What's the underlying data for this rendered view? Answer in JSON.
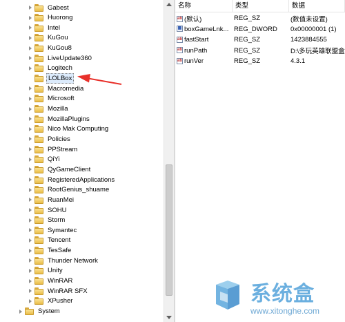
{
  "tree": {
    "items": [
      {
        "label": "Gabest"
      },
      {
        "label": "Huorong"
      },
      {
        "label": "Intel"
      },
      {
        "label": "KuGou"
      },
      {
        "label": "KuGou8"
      },
      {
        "label": "LiveUpdate360"
      },
      {
        "label": "Logitech"
      },
      {
        "label": "LOLBox",
        "selected": true
      },
      {
        "label": "Macromedia"
      },
      {
        "label": "Microsoft"
      },
      {
        "label": "Mozilla"
      },
      {
        "label": "MozillaPlugins"
      },
      {
        "label": "Nico Mak Computing"
      },
      {
        "label": "Policies"
      },
      {
        "label": "PPStream"
      },
      {
        "label": "QiYi"
      },
      {
        "label": "QyGameClient"
      },
      {
        "label": "RegisteredApplications"
      },
      {
        "label": "RootGenius_shuame"
      },
      {
        "label": "RuanMei"
      },
      {
        "label": "SOHU"
      },
      {
        "label": "Storm"
      },
      {
        "label": "Symantec"
      },
      {
        "label": "Tencent"
      },
      {
        "label": "TesSafe"
      },
      {
        "label": "Thunder Network"
      },
      {
        "label": "Unity"
      },
      {
        "label": "WinRAR"
      },
      {
        "label": "WinRAR SFX"
      },
      {
        "label": "XPusher"
      },
      {
        "label": "System",
        "root": true
      }
    ]
  },
  "values_pane": {
    "columns": {
      "name": "名称",
      "type": "类型",
      "data": "数据"
    },
    "rows": [
      {
        "icon": "string-value-icon",
        "name": "(默认)",
        "type": "REG_SZ",
        "data": "(数值未设置)"
      },
      {
        "icon": "dword-value-icon",
        "name": "boxGameLnk...",
        "type": "REG_DWORD",
        "data": "0x00000001 (1)"
      },
      {
        "icon": "string-value-icon",
        "name": "fastStart",
        "type": "REG_SZ",
        "data": "1423884555"
      },
      {
        "icon": "string-value-icon",
        "name": "runPath",
        "type": "REG_SZ",
        "data": "D:\\多玩英雄联盟盒子"
      },
      {
        "icon": "string-value-icon",
        "name": "runVer",
        "type": "REG_SZ",
        "data": "4.3.1"
      }
    ]
  },
  "watermark": {
    "brand": "系统盒",
    "url": "www.xitonghe.com"
  },
  "colors": {
    "annotation_arrow": "#e8302a",
    "folder": "#f0c85a",
    "watermark": "#5ba7dc"
  }
}
